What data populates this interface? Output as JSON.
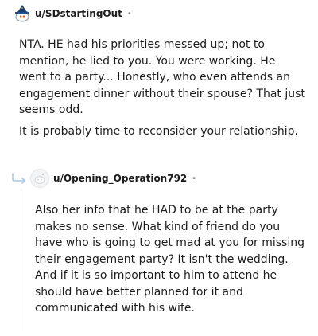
{
  "comment1": {
    "username": "u/SDstartingOut",
    "separator": "•",
    "paragraphs": [
      "NTA. HE had his priorities messed up; not to mention, he lied to you. You were working. He went to a party... Honestly, who even attends an engagement dinner without their spouse? That just seems odd.",
      "It is probably time to reconsider your relationship."
    ]
  },
  "comment2": {
    "username": "u/Opening_Operation792",
    "separator": "•",
    "paragraphs": [
      "Also her info that he HAD to be at the party makes no sense. What kind of friend do you have who is going to get mad at you for missing their engagement party? It isn't the wedding. And if it is so important to him to attend he should have better planned for it and communicated with his wife."
    ]
  },
  "colors": {
    "text": "#1c1c1c",
    "meta": "#878a8c",
    "avatar_hat": "#1a3b6e",
    "reply_arrow": "#a6c8e8"
  },
  "icons": {
    "avatar1": "wizard-snoo-avatar-icon",
    "avatar2": "default-snoo-avatar-icon",
    "reply": "reply-arrow-icon"
  }
}
